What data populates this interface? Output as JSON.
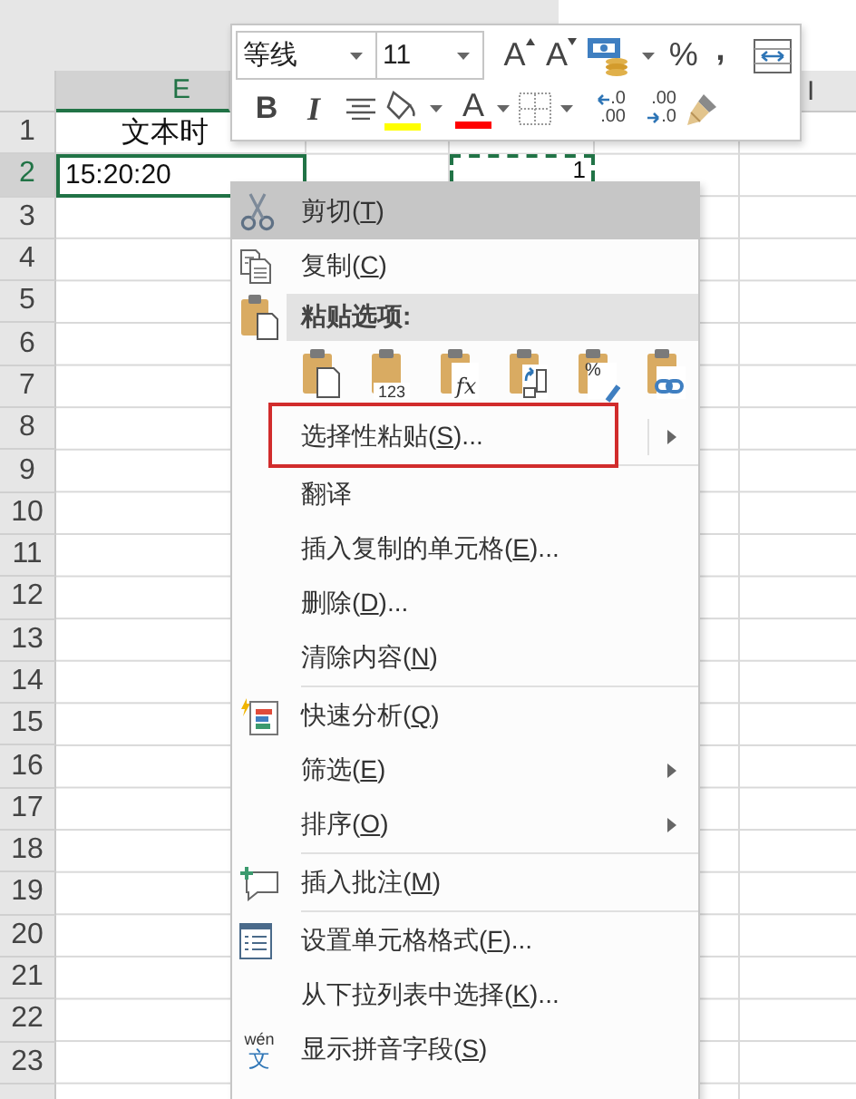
{
  "toolbar": {
    "font": {
      "value": "等线"
    },
    "size": {
      "value": "11"
    },
    "row_1": [
      {
        "kind": "grow",
        "label": "A"
      },
      {
        "kind": "shrink",
        "label": "A"
      },
      {
        "kind": "accounting"
      },
      {
        "kind": "percent",
        "label": "%"
      },
      {
        "kind": "comma",
        "label": ","
      },
      {
        "kind": "wrap"
      }
    ],
    "row_2": [
      {
        "kind": "bold",
        "label": "B"
      },
      {
        "kind": "italic",
        "label": "I"
      },
      {
        "kind": "align"
      },
      {
        "kind": "fill",
        "color": "#ffff00"
      },
      {
        "kind": "font-color",
        "label": "A",
        "color": "#ff0000"
      },
      {
        "kind": "borders"
      },
      {
        "kind": "increase-decimal",
        "top": ".0",
        "bottom": ".00"
      },
      {
        "kind": "decrease-decimal",
        "top": ".00",
        "bottom": ".0"
      },
      {
        "kind": "painter"
      }
    ]
  },
  "sheet": {
    "column_headers": [
      {
        "label": "E",
        "selected": true
      },
      {
        "label": "I",
        "selected": false
      }
    ],
    "rows": [
      {
        "label": "1",
        "selected": false,
        "cells": [
          {
            "text": "文本时",
            "selected": false,
            "copied": false
          }
        ]
      },
      {
        "label": "2",
        "selected": true,
        "cells": [
          {
            "text": "15:20:20",
            "selected": true,
            "copied": false
          },
          {
            "text": "1",
            "copied": true
          }
        ]
      },
      {
        "label": "3",
        "selected": false
      },
      {
        "label": "4",
        "selected": false
      },
      {
        "label": "5",
        "selected": false
      },
      {
        "label": "6",
        "selected": false
      },
      {
        "label": "7",
        "selected": false
      },
      {
        "label": "8",
        "selected": false
      },
      {
        "label": "9",
        "selected": false
      },
      {
        "label": "10",
        "selected": false
      },
      {
        "label": "11",
        "selected": false
      },
      {
        "label": "12",
        "selected": false
      },
      {
        "label": "13",
        "selected": false
      },
      {
        "label": "14",
        "selected": false
      },
      {
        "label": "15",
        "selected": false
      },
      {
        "label": "16",
        "selected": false
      },
      {
        "label": "17",
        "selected": false
      },
      {
        "label": "18",
        "selected": false
      },
      {
        "label": "19",
        "selected": false
      },
      {
        "label": "20",
        "selected": false
      },
      {
        "label": "21",
        "selected": false
      },
      {
        "label": "22",
        "selected": false
      },
      {
        "label": "23",
        "selected": false
      }
    ]
  },
  "context_menu": {
    "items": [
      {
        "kind": "cut",
        "before": "剪切(",
        "key": "T",
        "after": ")",
        "highlighted": true
      },
      {
        "kind": "copy",
        "before": "复制(",
        "key": "C",
        "after": ")",
        "highlighted": false
      },
      {
        "kind": "paste-header",
        "text": "粘贴选项:"
      },
      {
        "kind": "paste-options",
        "options": [
          {
            "kind": "paste"
          },
          {
            "kind": "values",
            "caption": "123"
          },
          {
            "kind": "formulas",
            "caption": "fx"
          },
          {
            "kind": "transpose"
          },
          {
            "kind": "formatting",
            "caption": "%"
          },
          {
            "kind": "link"
          }
        ]
      },
      {
        "kind": "command",
        "before": "选择性粘贴(",
        "key": "S",
        "after": ")...",
        "highlighted": false,
        "submenu": true,
        "outlined": true
      },
      {
        "kind": "separator"
      },
      {
        "kind": "command",
        "before": "翻译",
        "highlighted": false
      },
      {
        "kind": "command",
        "before": "插入复制的单元格(",
        "key": "E",
        "after": ")...",
        "highlighted": false
      },
      {
        "kind": "command",
        "before": "删除(",
        "key": "D",
        "after": ")...",
        "highlighted": false
      },
      {
        "kind": "command",
        "before": "清除内容(",
        "key": "N",
        "after": ")",
        "highlighted": false
      },
      {
        "kind": "separator"
      },
      {
        "kind": "quick-analysis",
        "before": "快速分析(",
        "key": "Q",
        "after": ")",
        "highlighted": false
      },
      {
        "kind": "command",
        "before": "筛选(",
        "key": "E",
        "after": ")",
        "highlighted": false,
        "submenu": true
      },
      {
        "kind": "command",
        "before": "排序(",
        "key": "O",
        "after": ")",
        "highlighted": false,
        "submenu": true
      },
      {
        "kind": "separator"
      },
      {
        "kind": "comment",
        "before": "插入批注(",
        "key": "M",
        "after": ")",
        "highlighted": false
      },
      {
        "kind": "separator"
      },
      {
        "kind": "format-cells",
        "before": "设置单元格格式(",
        "key": "F",
        "after": ")...",
        "highlighted": false
      },
      {
        "kind": "command",
        "before": "从下拉列表中选择(",
        "key": "K",
        "after": ")...",
        "highlighted": false
      },
      {
        "kind": "pinyin",
        "before": "显示拼音字段(",
        "key": "S",
        "after": ")",
        "highlighted": false,
        "icon_top": "wén",
        "icon_bottom": "文"
      }
    ]
  }
}
